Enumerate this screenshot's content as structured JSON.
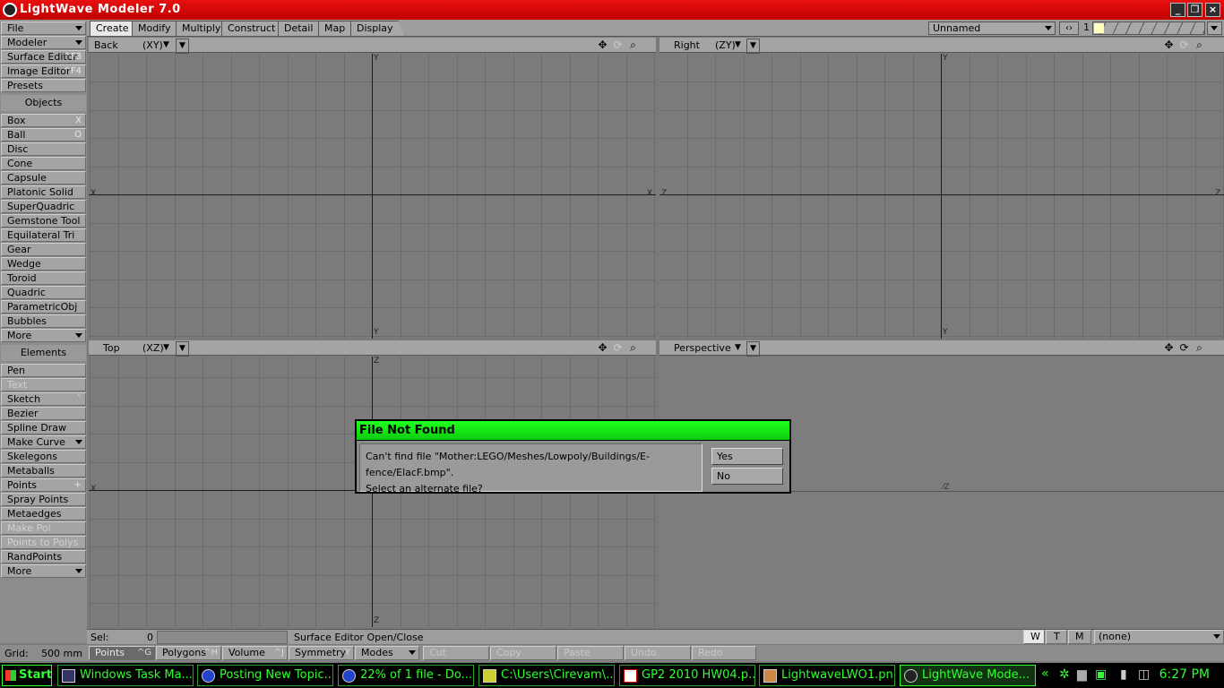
{
  "window": {
    "title": "LightWave Modeler 7.0"
  },
  "tabs": [
    "Create",
    "Modify",
    "Multiply",
    "Construct",
    "Detail",
    "Map",
    "Display"
  ],
  "object_selector": {
    "value": "Unnamed",
    "layer": "1"
  },
  "sidebar": {
    "top_menus": [
      {
        "label": "File",
        "shortcut": ""
      },
      {
        "label": "Modeler",
        "shortcut": ""
      },
      {
        "label": "Surface Editor",
        "shortcut": "^F3"
      },
      {
        "label": "Image Editor",
        "shortcut": "^F4"
      },
      {
        "label": "Presets",
        "shortcut": ""
      }
    ],
    "objects_header": "Objects",
    "objects": [
      {
        "label": "Box",
        "shortcut": "X"
      },
      {
        "label": "Ball",
        "shortcut": "O"
      },
      {
        "label": "Disc",
        "shortcut": ""
      },
      {
        "label": "Cone",
        "shortcut": ""
      },
      {
        "label": "Capsule",
        "shortcut": ""
      },
      {
        "label": "Platonic Solid",
        "shortcut": ""
      },
      {
        "label": "SuperQuadric",
        "shortcut": ""
      },
      {
        "label": "Gemstone Tool",
        "shortcut": ""
      },
      {
        "label": "Equilateral Tri",
        "shortcut": ""
      },
      {
        "label": "Gear",
        "shortcut": ""
      },
      {
        "label": "Wedge",
        "shortcut": ""
      },
      {
        "label": "Toroid",
        "shortcut": ""
      },
      {
        "label": "Quadric",
        "shortcut": ""
      },
      {
        "label": "ParametricObj",
        "shortcut": ""
      },
      {
        "label": "Bubbles",
        "shortcut": ""
      },
      {
        "label": "More",
        "shortcut": ""
      }
    ],
    "elements_header": "Elements",
    "elements": [
      {
        "label": "Pen",
        "shortcut": ""
      },
      {
        "label": "Text",
        "shortcut": ""
      },
      {
        "label": "Sketch",
        "shortcut": "`"
      },
      {
        "label": "Bezier",
        "shortcut": ""
      },
      {
        "label": "Spline Draw",
        "shortcut": ""
      },
      {
        "label": "Make Curve",
        "shortcut": ""
      },
      {
        "label": "Skelegons",
        "shortcut": ""
      },
      {
        "label": "Metaballs",
        "shortcut": ""
      },
      {
        "label": "Points",
        "shortcut": "+"
      },
      {
        "label": "Spray Points",
        "shortcut": ""
      },
      {
        "label": "Metaedges",
        "shortcut": ""
      },
      {
        "label": "Make Pol",
        "shortcut": ""
      },
      {
        "label": "Points to Polys",
        "shortcut": ""
      },
      {
        "label": "RandPoints",
        "shortcut": ""
      },
      {
        "label": "More",
        "shortcut": ""
      }
    ]
  },
  "viewports": [
    {
      "name": "Back",
      "axis": "(XY)",
      "h_left": "X",
      "h_right": "X",
      "v_top": "Y",
      "v_bottom": "Y"
    },
    {
      "name": "Right",
      "axis": "(ZY)",
      "h_left": "Z",
      "h_right": "Z",
      "v_top": "Y",
      "v_bottom": "Y"
    },
    {
      "name": "Top",
      "axis": "(XZ)",
      "h_left": "X",
      "h_right": "",
      "v_top": "Z",
      "v_bottom": "Z"
    },
    {
      "name": "Perspective",
      "axis": "",
      "h_left": "",
      "h_right": "",
      "v_top": "",
      "v_bottom": ""
    }
  ],
  "status": {
    "sel_label": "Sel:",
    "sel_value": "0",
    "message": "Surface Editor Open/Close",
    "wtm": [
      "W",
      "T",
      "M"
    ],
    "surface": "(none)"
  },
  "bottom": {
    "grid_label": "Grid:",
    "grid_value": "500 mm",
    "buttons": [
      {
        "label": "Points",
        "shortcut": "^G"
      },
      {
        "label": "Polygons",
        "shortcut": "^H"
      },
      {
        "label": "Volume",
        "shortcut": "^J"
      },
      {
        "label": "Symmetry",
        "shortcut": "Y"
      },
      {
        "label": "Modes",
        "shortcut": ""
      },
      {
        "label": "Cut",
        "shortcut": ""
      },
      {
        "label": "Copy",
        "shortcut": ""
      },
      {
        "label": "Paste",
        "shortcut": ""
      },
      {
        "label": "Undo",
        "shortcut": ""
      },
      {
        "label": "Redo",
        "shortcut": ""
      }
    ]
  },
  "dialog": {
    "title": "File Not Found",
    "line1": "Can't find file \"Mother:LEGO/Meshes/Lowpoly/Buildings/E-fence/ElacF.bmp\".",
    "line2": "Select an alternate file?",
    "yes": "Yes",
    "no": "No"
  },
  "taskbar": {
    "start": "Start",
    "tasks": [
      "Windows Task Ma...",
      "Posting New Topic...",
      "22% of 1 file - Do...",
      "C:\\Users\\Cirevam\\...",
      "GP2 2010 HW04.p...",
      "LightwaveLWO1.pn...",
      "LightWave Mode..."
    ],
    "chevron": "«",
    "clock": "6:27 PM"
  },
  "colors": {
    "title_red": "#d00000",
    "dialog_green": "#1ee81e",
    "taskbar_green": "#30ff30"
  }
}
